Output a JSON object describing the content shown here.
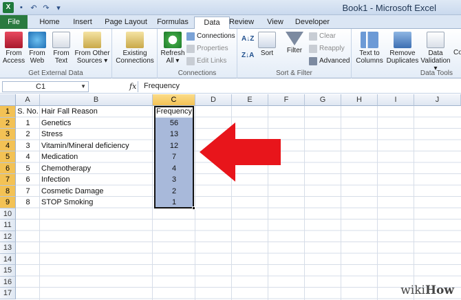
{
  "window": {
    "title": "Book1 - Microsoft Excel",
    "app_icon": "X"
  },
  "quick_access": [
    "save-icon",
    "undo-icon",
    "redo-icon",
    "customize-icon"
  ],
  "tabs": [
    "File",
    "Home",
    "Insert",
    "Page Layout",
    "Formulas",
    "Data",
    "Review",
    "View",
    "Developer"
  ],
  "active_tab": "Data",
  "ribbon": {
    "get_external": {
      "label": "Get External Data",
      "buttons": [
        {
          "line1": "From",
          "line2": "Access"
        },
        {
          "line1": "From",
          "line2": "Web"
        },
        {
          "line1": "From",
          "line2": "Text"
        },
        {
          "line1": "From Other",
          "line2": "Sources ▾"
        }
      ]
    },
    "existing": {
      "line1": "Existing",
      "line2": "Connections"
    },
    "connections": {
      "label": "Connections",
      "refresh1": "Refresh",
      "refresh2": "All ▾",
      "items": [
        "Connections",
        "Properties",
        "Edit Links"
      ]
    },
    "sort_filter": {
      "label": "Sort & Filter",
      "sort": "Sort",
      "filter": "Filter",
      "clear": "Clear",
      "reapply": "Reapply",
      "advanced": "Advanced"
    },
    "data_tools": {
      "label": "Data Tools",
      "text1": "Text to",
      "text2": "Columns",
      "remove1": "Remove",
      "remove2": "Duplicates",
      "valid1": "Data",
      "valid2": "Validation ▾",
      "cut": "Co"
    }
  },
  "formula_bar": {
    "name_box": "C1",
    "fx": "fx",
    "value": "Frequency"
  },
  "columns": [
    "A",
    "B",
    "C",
    "D",
    "E",
    "F",
    "G",
    "H",
    "I",
    "J"
  ],
  "rows": [
    "1",
    "2",
    "3",
    "4",
    "5",
    "6",
    "7",
    "8",
    "9",
    "10",
    "11",
    "12",
    "13",
    "14",
    "15",
    "16",
    "17"
  ],
  "sheet": {
    "header": {
      "sno": "S. No.",
      "reason": "Hair Fall Reason",
      "freq": "Frequency"
    },
    "data": [
      {
        "sno": "1",
        "reason": "Genetics",
        "freq": "56"
      },
      {
        "sno": "2",
        "reason": "Stress",
        "freq": "13"
      },
      {
        "sno": "3",
        "reason": "Vitamin/Mineral deficiency",
        "freq": "12"
      },
      {
        "sno": "4",
        "reason": "Medication",
        "freq": "7"
      },
      {
        "sno": "5",
        "reason": "Chemotherapy",
        "freq": "4"
      },
      {
        "sno": "6",
        "reason": "Infection",
        "freq": "3"
      },
      {
        "sno": "7",
        "reason": "Cosmetic Damage",
        "freq": "2"
      },
      {
        "sno": "8",
        "reason": "STOP Smoking",
        "freq": "1"
      }
    ]
  },
  "annotation": {
    "arrow_color": "#e8151b",
    "watermark_a": "wiki",
    "watermark_b": "How"
  }
}
